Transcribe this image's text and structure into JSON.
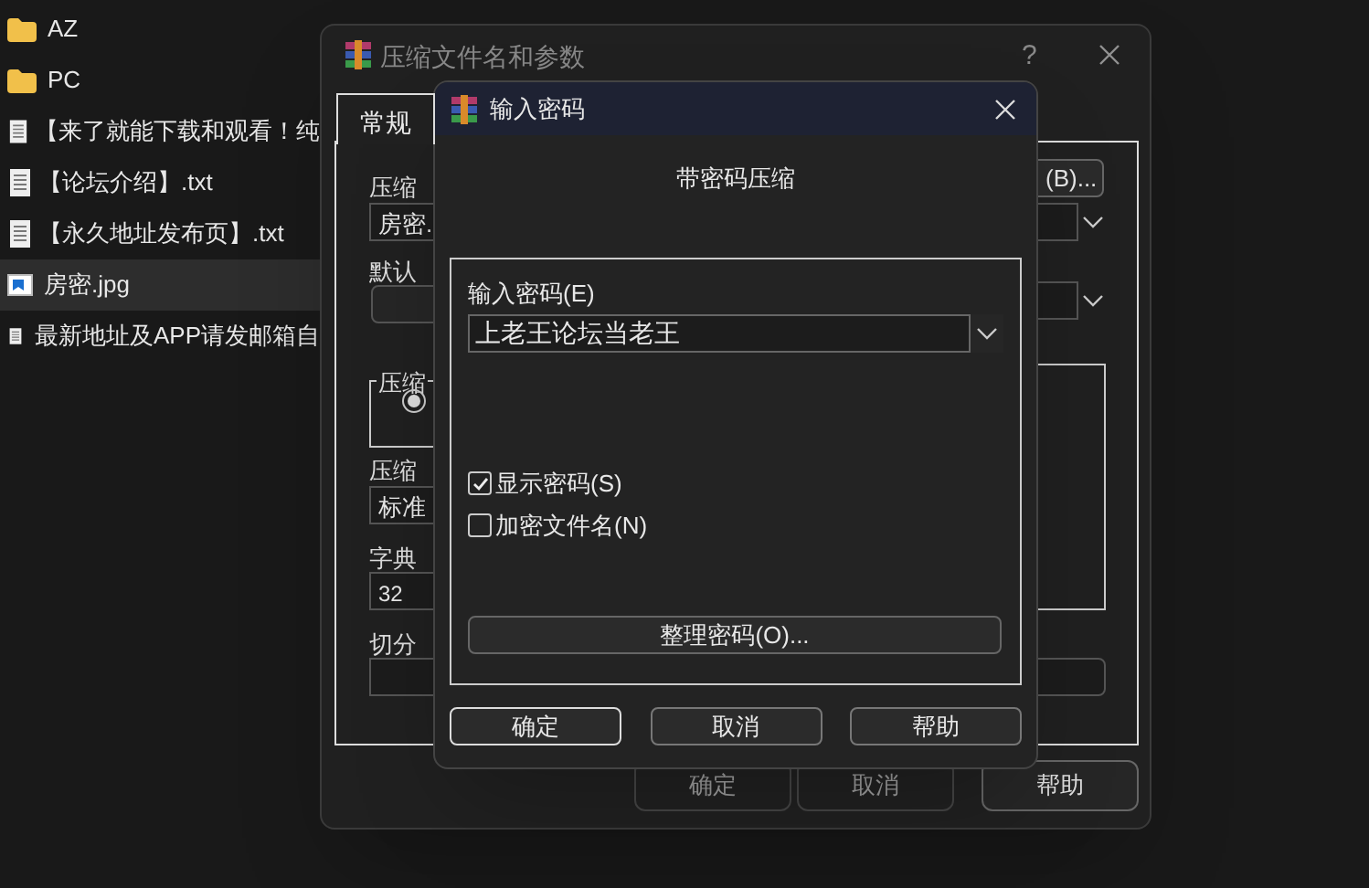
{
  "explorer": {
    "items": [
      {
        "name": "AZ",
        "kind": "folder",
        "selected": false
      },
      {
        "name": "PC",
        "kind": "folder",
        "selected": false
      },
      {
        "name": "【来了就能下载和观看！纯",
        "kind": "text",
        "selected": false
      },
      {
        "name": "【论坛介绍】.txt",
        "kind": "text",
        "selected": false
      },
      {
        "name": "【永久地址发布页】.txt",
        "kind": "text",
        "selected": false
      },
      {
        "name": "房密.jpg",
        "kind": "image",
        "selected": true
      },
      {
        "name": "最新地址及APP请发邮箱自",
        "kind": "text",
        "selected": false
      }
    ]
  },
  "archive_window": {
    "title": "压缩文件名和参数",
    "help": "?",
    "tabs": [
      {
        "label": "常规",
        "selected": true
      }
    ],
    "archive_name_label": "压缩",
    "archive_name_value": "房密.",
    "browse_button": "(B)...",
    "profile_label": "默认",
    "group_label": "压缩",
    "radio_selected": true,
    "method_label": "压缩",
    "method_value": "标准",
    "dict_label": "字典",
    "dict_value": "32",
    "split_label": "切分",
    "buttons": [
      {
        "label": "确定",
        "disabled": true
      },
      {
        "label": "取消",
        "disabled": true
      },
      {
        "label": "帮助",
        "disabled": false
      }
    ]
  },
  "password_dialog": {
    "title": "输入密码",
    "heading": "带密码压缩",
    "password_label": "输入密码(E)",
    "password_value": "上老王论坛当老王",
    "checkboxes": [
      {
        "label": "显示密码(S)",
        "checked": true
      },
      {
        "label": "加密文件名(N)",
        "checked": false
      }
    ],
    "organize_button": "整理密码(O)...",
    "buttons": [
      {
        "label": "确定",
        "focused": true
      },
      {
        "label": "取消",
        "focused": false
      },
      {
        "label": "帮助",
        "focused": false
      }
    ]
  }
}
